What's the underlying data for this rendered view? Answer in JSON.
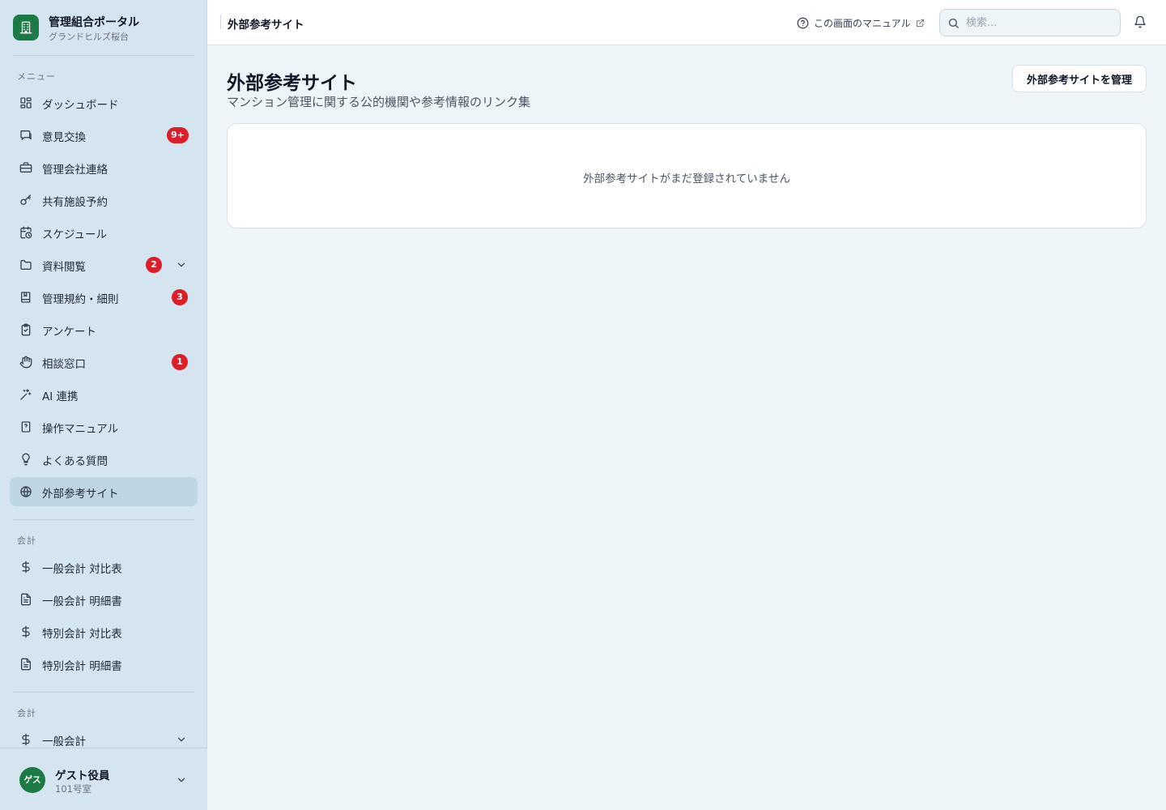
{
  "brand": {
    "title": "管理組合ポータル",
    "subtitle": "グランドヒルズ桜台",
    "accent": "#1b7a45"
  },
  "sidebar": {
    "menu_label": "メニュー",
    "items": [
      {
        "label": "ダッシュボード",
        "icon": "dashboard-icon"
      },
      {
        "label": "意見交換",
        "icon": "chat-icon",
        "badge": "9+"
      },
      {
        "label": "管理会社連絡",
        "icon": "briefcase-icon"
      },
      {
        "label": "共有施設予約",
        "icon": "key-icon"
      },
      {
        "label": "スケジュール",
        "icon": "calendar-clock-icon"
      },
      {
        "label": "資料閲覧",
        "icon": "folder-icon",
        "badge": "2",
        "expandable": true
      },
      {
        "label": "管理規約・細則",
        "icon": "book-icon",
        "badge": "3"
      },
      {
        "label": "アンケート",
        "icon": "clipboard-icon"
      },
      {
        "label": "相談窓口",
        "icon": "hand-icon",
        "badge": "1"
      },
      {
        "label": "AI 連携",
        "icon": "sparkle-wand-icon"
      },
      {
        "label": "操作マニュアル",
        "icon": "manual-book-icon"
      },
      {
        "label": "よくある質問",
        "icon": "lightbulb-icon"
      },
      {
        "label": "外部参考サイト",
        "icon": "globe-icon",
        "active": true
      }
    ],
    "accounting_label": "会計",
    "accounting_items": [
      {
        "label": "一般会計 対比表",
        "icon": "dollar-icon"
      },
      {
        "label": "一般会計 明細書",
        "icon": "document-icon"
      },
      {
        "label": "特別会計 対比表",
        "icon": "dollar-icon"
      },
      {
        "label": "特別会計 明細書",
        "icon": "document-icon"
      }
    ],
    "accounting2_label": "会計",
    "accounting2_items": [
      {
        "label": "一般会計",
        "icon": "dollar-icon",
        "expandable": true
      }
    ],
    "badge_color": "#dc1e28"
  },
  "user": {
    "avatar_text": "ゲス",
    "name": "ゲスト役員",
    "room": "101号室"
  },
  "header": {
    "title": "外部参考サイト",
    "manual_link": "この画面のマニュアル",
    "search_placeholder": "検索..."
  },
  "main": {
    "title": "外部参考サイト",
    "subtitle": "マンション管理に関する公的機関や参考情報のリンク集",
    "manage_button": "外部参考サイトを管理",
    "empty_message": "外部参考サイトがまだ登録されていません"
  }
}
